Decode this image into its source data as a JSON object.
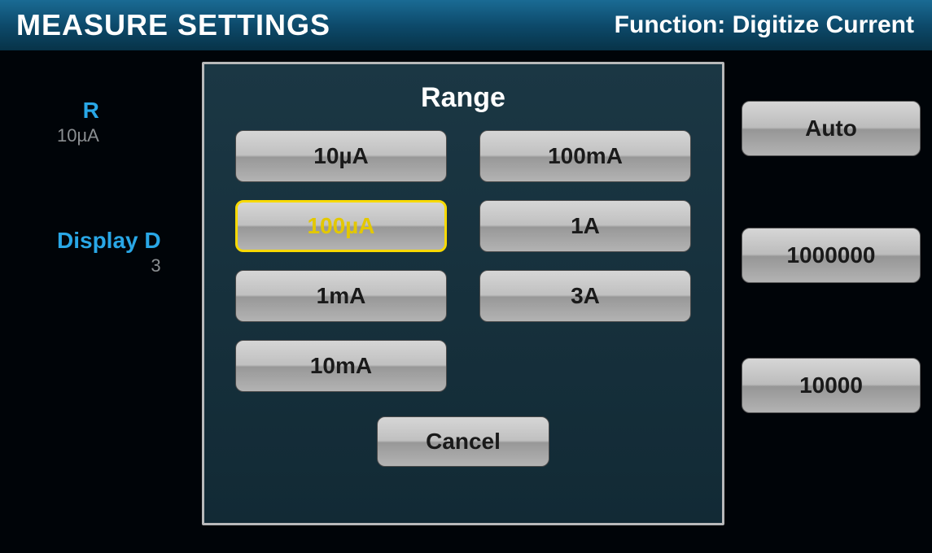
{
  "header": {
    "title": "MEASURE SETTINGS",
    "function_prefix": "Function: ",
    "function_value": "Digitize Current"
  },
  "background": {
    "range": {
      "label": "Range",
      "partial_label_visible": "R",
      "sub": "10µA"
    },
    "display_digits": {
      "label": "Display Digits",
      "partial_label_visible": "Display D",
      "sub": "3"
    }
  },
  "side_buttons": {
    "auto": "Auto",
    "count": "1000000",
    "rate": "10000"
  },
  "dialog": {
    "title": "Range",
    "options": [
      "10µA",
      "100µA",
      "1mA",
      "10mA",
      "100mA",
      "1A",
      "3A"
    ],
    "selected_index": 1,
    "cancel_label": "Cancel"
  }
}
